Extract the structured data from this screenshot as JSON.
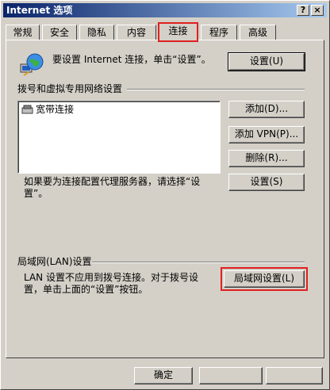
{
  "window": {
    "title": "Internet 选项",
    "help_button": "?",
    "close_button": "×"
  },
  "tabs": [
    {
      "label": "常规"
    },
    {
      "label": "安全"
    },
    {
      "label": "隐私"
    },
    {
      "label": "内容"
    },
    {
      "label": "连接",
      "active": true
    },
    {
      "label": "程序"
    },
    {
      "label": "高级"
    }
  ],
  "setup": {
    "icon": "globe-network-icon",
    "text": "要设置 Internet 连接，单击“设置”。",
    "button": "设置(U)"
  },
  "dialup": {
    "group_label": "拨号和虚拟专用网络设置",
    "connections": [
      {
        "icon": "dialup-connection-icon",
        "label": "宽带连接"
      }
    ],
    "add_button": "添加(D)...",
    "add_vpn_button": "添加 VPN(P)...",
    "remove_button": "删除(R)...",
    "proxy_text": "如果要为连接配置代理服务器，请选择“设置”。",
    "settings_button": "设置(S)"
  },
  "lan": {
    "group_label": "局域网(LAN)设置",
    "text": "LAN 设置不应用到拨号连接。对于拨号设置，单击上面的“设置”按钮。",
    "button": "局域网设置(L)"
  },
  "footer": {
    "ok_button": "确定"
  },
  "colors": {
    "title_gradient_start": "#0a246a",
    "highlight": "#e02020",
    "face": "#d4d0c8"
  }
}
